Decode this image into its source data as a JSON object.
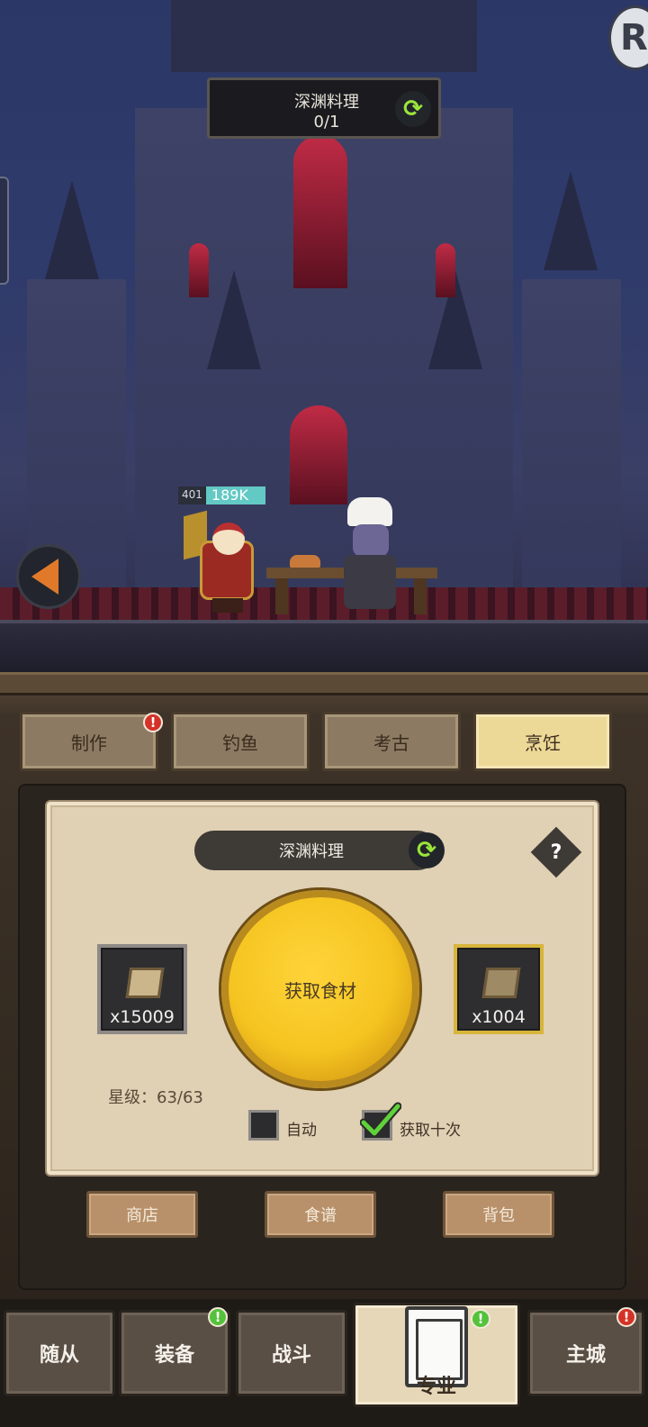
{
  "scene": {
    "quest": {
      "title": "深渊料理",
      "progress": "0/1"
    },
    "hero": {
      "level": "401",
      "hp": "189K"
    }
  },
  "tabs": [
    {
      "label": "制作",
      "badge": "!"
    },
    {
      "label": "钓鱼"
    },
    {
      "label": "考古"
    },
    {
      "label": "烹饪",
      "active": true
    }
  ],
  "cooking": {
    "recipe": "深渊料理",
    "help": "?",
    "left_slot_count": "x15009",
    "right_slot_count": "x1004",
    "action_label": "获取食材",
    "star_level": "星级：63/63",
    "auto_label": "自动",
    "auto_checked": false,
    "ten_label": "获取十次",
    "ten_checked": true
  },
  "footer_buttons": {
    "shop": "商店",
    "recipes": "食谱",
    "bag": "背包"
  },
  "bottom_nav": [
    {
      "label": "随从"
    },
    {
      "label": "装备",
      "badge": "!"
    },
    {
      "label": "战斗"
    },
    {
      "label": "专业",
      "active": true,
      "badge": "!"
    },
    {
      "label": "主城",
      "badge": "!"
    }
  ],
  "colors": {
    "accent_gold": "#f5c420",
    "active_tab": "#ecd897",
    "refresh_green": "#9be53a",
    "badge_red": "#d43228",
    "badge_green": "#54c23a"
  }
}
